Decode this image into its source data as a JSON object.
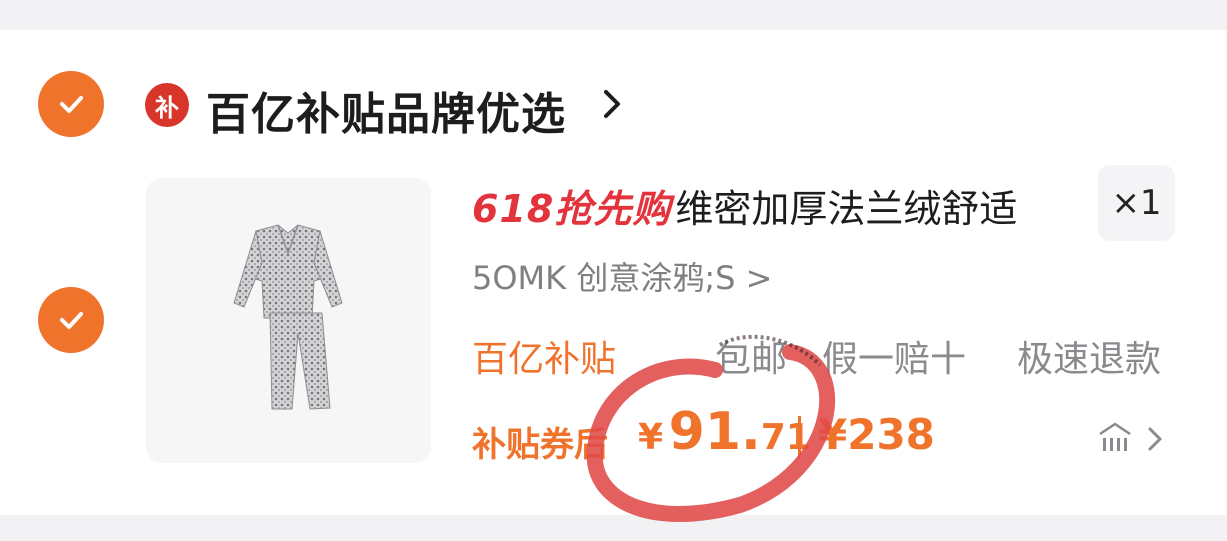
{
  "shop": {
    "badge_char": "补",
    "name": "百亿补贴品牌优选"
  },
  "item": {
    "promo_tag": "618抢先购",
    "title": "维密加厚法兰绒舒适",
    "quantity": "×1",
    "sku": "5OMK 创意涂鸦;S >",
    "tags": {
      "subsidy": "百亿补贴",
      "shipping": "包邮",
      "fake_compensation": "假一赔十",
      "fast_refund": "极速退款"
    },
    "coupon_label": "补贴券后",
    "price_currency": "¥",
    "price_integer": "91.",
    "price_decimal": "71",
    "original_price": "¥238"
  },
  "icons": [
    "check-icon",
    "subsidy-badge-icon",
    "chevron-right-icon",
    "price-trend-icon"
  ],
  "colors": {
    "accent": "#f0732c",
    "promo_red": "#e3343d",
    "badge_red": "#d9362b",
    "annotation_red": "#e04a48"
  }
}
